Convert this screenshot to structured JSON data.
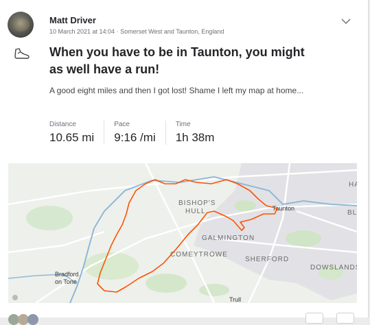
{
  "athlete": {
    "name": "Matt Driver"
  },
  "activity": {
    "meta": "10 March 2021 at 14:04 · Somerset West and Taunton, England",
    "title": "When you have to be in Taunton, you might as well have a run!",
    "description": "A good eight miles and then I got lost! Shame I left my map at home...",
    "stats": [
      {
        "label": "Distance",
        "value": "10.65 mi"
      },
      {
        "label": "Pace",
        "value": "9:16 /mi"
      },
      {
        "label": "Time",
        "value": "1h 38m"
      }
    ]
  },
  "map": {
    "labels": {
      "bishops_hull": "BISHOP'S HULL",
      "taunton": "Taunton",
      "galmington": "GALMINGTON",
      "comeytrowe": "COMEYTROWE",
      "sherford": "SHERFORD",
      "dowslands": "DOWSLANDS",
      "bradford": "Bradford on Tone",
      "trull": "Trull",
      "ha": "HA",
      "bl": "BL"
    },
    "route_color": "#fc5200"
  },
  "icons": {
    "activity_type": "shoe-icon",
    "menu": "chevron-down-icon"
  }
}
